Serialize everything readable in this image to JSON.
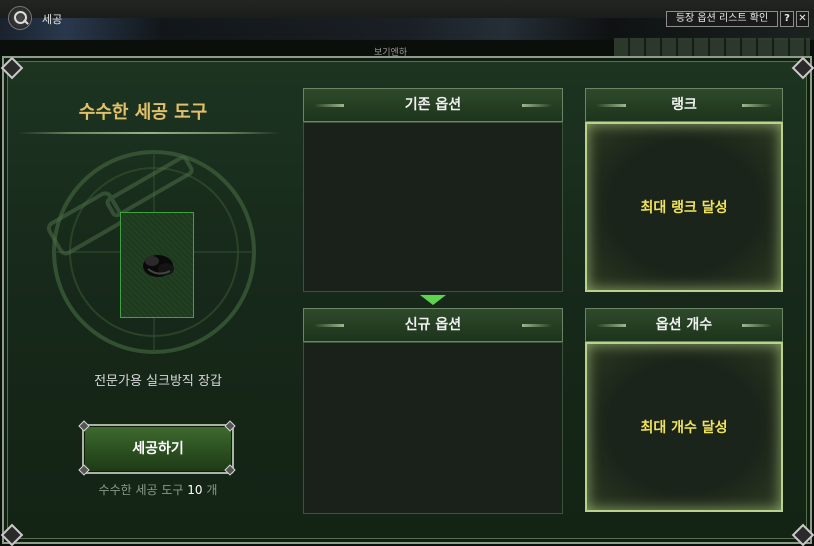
{
  "window": {
    "title": "세공",
    "list_button_label": "등장 옵션 리스트 확인",
    "help_label": "?",
    "close_label": "✕",
    "background_text": "보기엔하"
  },
  "left": {
    "tool_title": "수수한 세공 도구",
    "item_name": "전문가용 실크방직 장갑",
    "process_button_label": "세공하기",
    "count_prefix": "수수한 세공 도구",
    "count_value": "10",
    "count_suffix": "개"
  },
  "center": {
    "existing_header": "기존 옵션",
    "new_header": "신규 옵션"
  },
  "right": {
    "rank_header": "랭크",
    "rank_status": "최대 랭크 달성",
    "option_count_header": "옵션 개수",
    "option_count_status": "최대 개수 달성"
  },
  "colors": {
    "title_gold": "#e2c06a",
    "status_yellow": "#f1e35a",
    "arrow_green": "#5fd34e",
    "panel_green": "#1d3421"
  },
  "icons": [
    "search-icon",
    "help-icon",
    "close-icon",
    "glove-icon",
    "arrow-down-icon"
  ]
}
